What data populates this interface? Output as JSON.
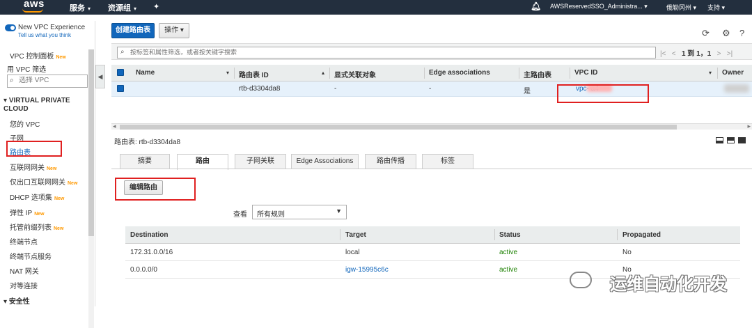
{
  "topbar": {
    "logo": "aws",
    "menus": [
      "服务",
      "资源组"
    ],
    "account": "AWSReservedSSO_Administra...",
    "region": "俄勒冈州",
    "support": "支持"
  },
  "sidebar": {
    "new_experience_title": "New VPC Experience",
    "new_experience_link": "Tell us what you think",
    "dashboard": "VPC 控制面板",
    "new_badge": "New",
    "filter_by_vpc": "用 VPC 筛选",
    "filter_placeholder": "选择 VPC",
    "section_vpc": "VIRTUAL PRIVATE CLOUD",
    "section_security": "安全性",
    "items": [
      {
        "label": "您的 VPC",
        "new": ""
      },
      {
        "label": "子网",
        "new": ""
      },
      {
        "label": "路由表",
        "new": ""
      },
      {
        "label": "互联网网关",
        "new": "New"
      },
      {
        "label": "仅出口互联网网关",
        "new": "New"
      },
      {
        "label": "DHCP 选项集",
        "new": "New"
      },
      {
        "label": "弹性 IP",
        "new": "New"
      },
      {
        "label": "托管前缀列表",
        "new": "New"
      },
      {
        "label": "终端节点",
        "new": ""
      },
      {
        "label": "终端节点服务",
        "new": ""
      },
      {
        "label": "NAT 网关",
        "new": ""
      },
      {
        "label": "对等连接",
        "new": ""
      }
    ]
  },
  "toolbar": {
    "create_label": "创建路由表",
    "actions_label": "操作",
    "search_placeholder": "按标签和属性筛选，或者按关键字搜索",
    "pager_text": "1 到 1，1"
  },
  "grid": {
    "columns": [
      "Name",
      "路由表 ID",
      "显式关联对象",
      "Edge associations",
      "主路由表",
      "VPC ID",
      "Owner"
    ],
    "row": {
      "name": "",
      "route_table_id": "rtb-d3304da8",
      "explicit": "-",
      "edge": "-",
      "main": "是",
      "vpc_id": "vpc-        a4"
    }
  },
  "detail": {
    "label": "路由表: rtb-d3304da8",
    "tabs": [
      "摘要",
      "路由",
      "子网关联",
      "Edge Associations",
      "路由传播",
      "标签"
    ],
    "edit_routes_label": "编辑路由",
    "view_label": "查看",
    "view_value": "所有规则",
    "route_columns": [
      "Destination",
      "Target",
      "Status",
      "Propagated"
    ],
    "routes": [
      {
        "destination": "172.31.0.0/16",
        "target": "local",
        "status": "active",
        "propagated": "No"
      },
      {
        "destination": "0.0.0.0/0",
        "target": "igw-15995c6c",
        "status": "active",
        "propagated": "No"
      }
    ]
  },
  "watermark": "运维自动化开发",
  "colors": {
    "primary": "#1166bb",
    "active": "#1d8102",
    "highlight": "#e02020",
    "new_badge": "#ff9900"
  }
}
